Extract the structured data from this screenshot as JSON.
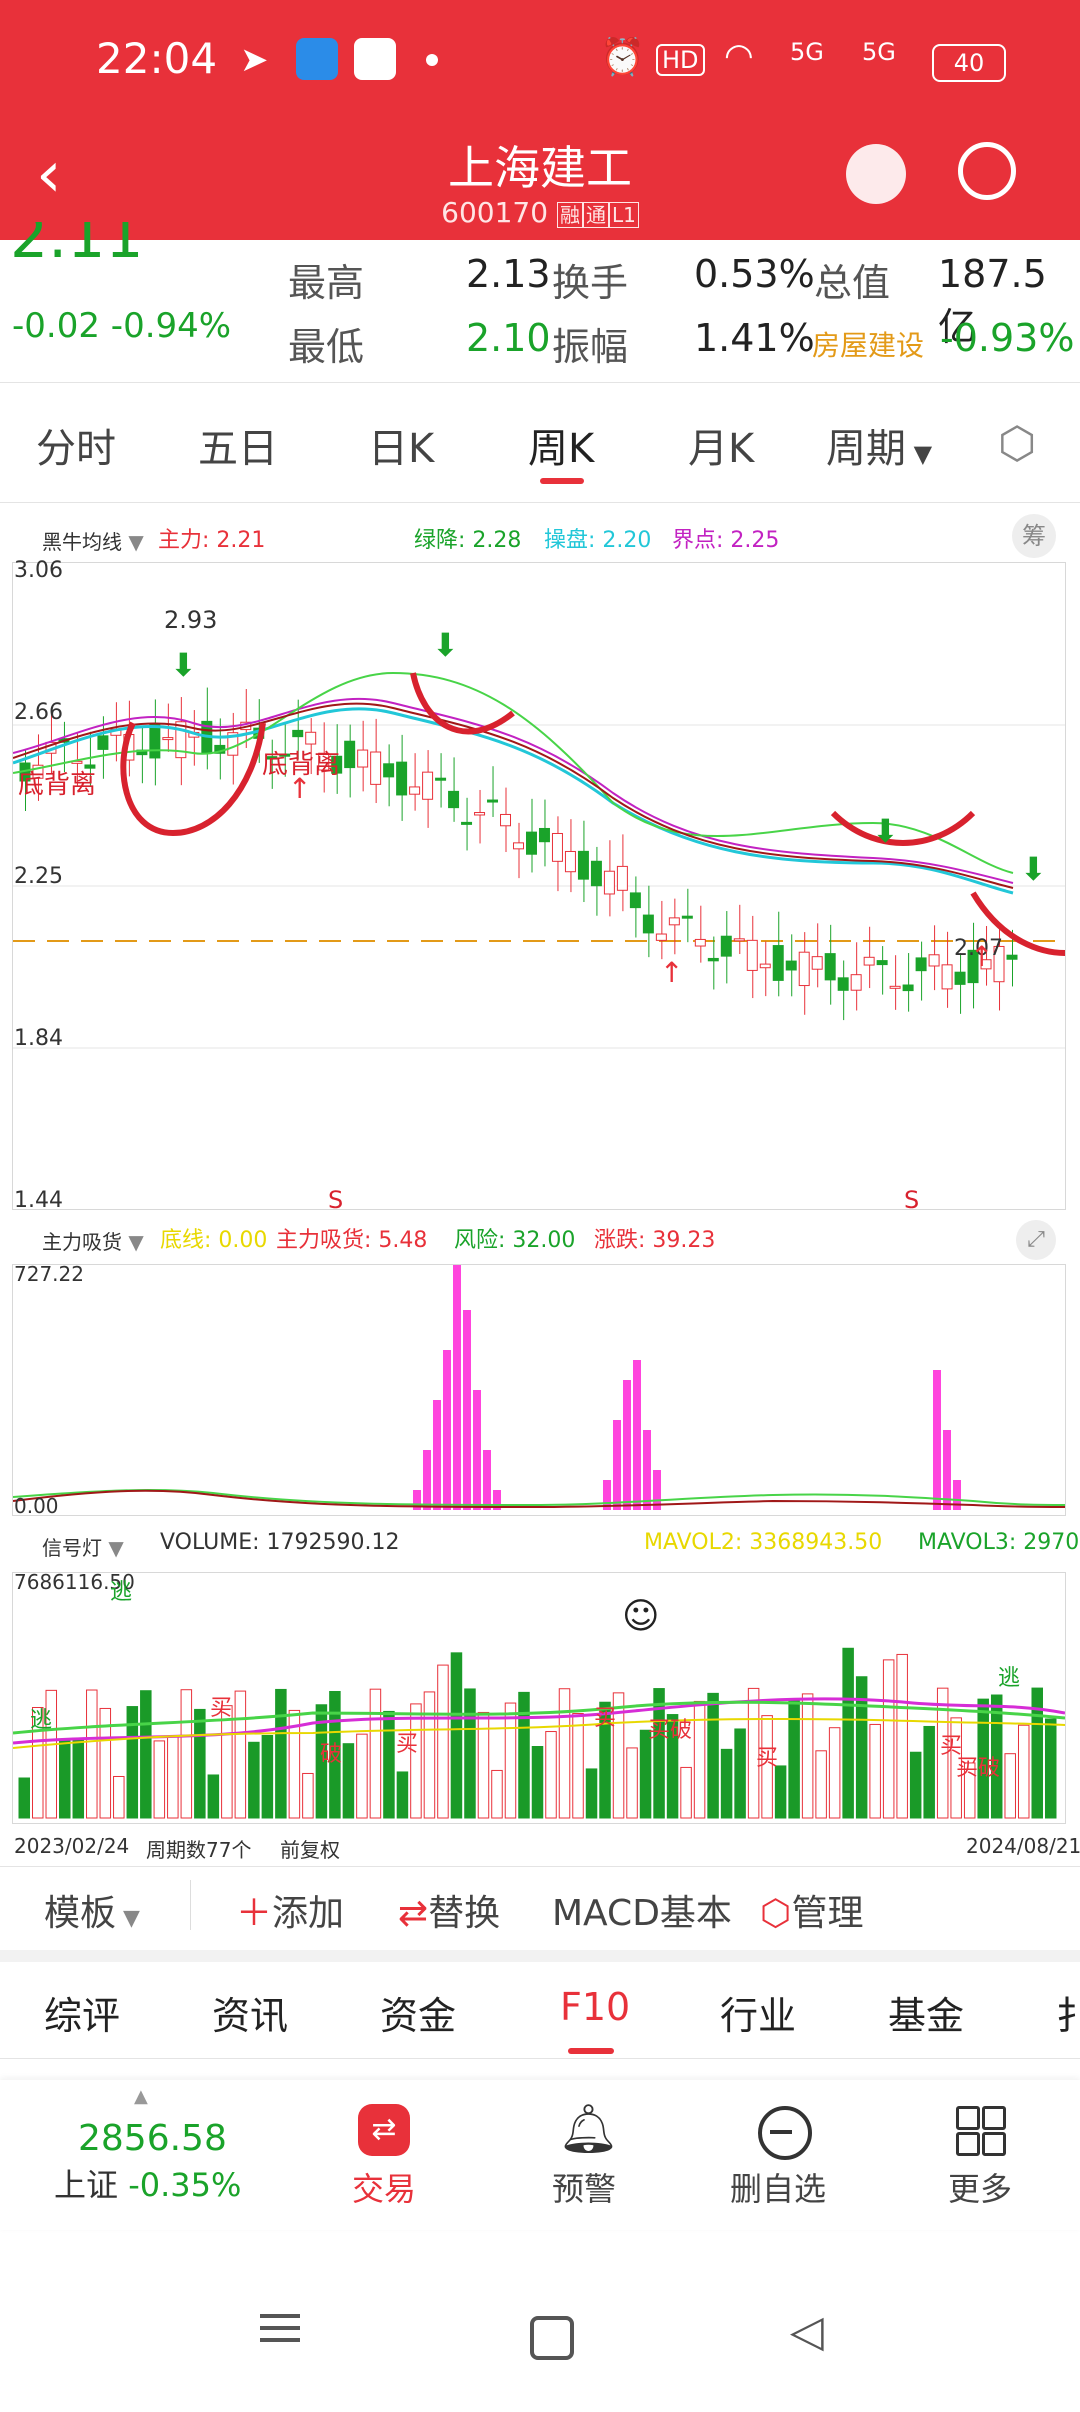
{
  "status": {
    "time": "22:04",
    "hd_badge": "HD",
    "net1": "5G",
    "net2": "5G",
    "battery": "40"
  },
  "header": {
    "title": "上海建工",
    "code": "600170",
    "badge1": "融",
    "badge2": "通",
    "badge3": "L1"
  },
  "quote": {
    "price": "2.11",
    "change": "-0.02",
    "change_pct": "-0.94%",
    "high_label": "最高",
    "high": "2.13",
    "turnover_label": "换手",
    "turnover": "0.53%",
    "cap_label": "总值",
    "cap": "187.5亿",
    "low_label": "最低",
    "low": "2.10",
    "amp_label": "振幅",
    "amp": "1.41%",
    "sector_label": "房屋建设",
    "sector_pct": "-0.93%"
  },
  "tabs": [
    "分时",
    "五日",
    "日K",
    "周K",
    "月K",
    "周期"
  ],
  "active_tab": "周K",
  "main_chart": {
    "indicator_name": "黑牛均线",
    "legend": [
      {
        "text": "主力: 2.21",
        "color": "#e8313a"
      },
      {
        "text": "绿降: 2.28",
        "color": "#1aa32a"
      },
      {
        "text": "操盘: 2.20",
        "color": "#22c7d8"
      },
      {
        "text": "界点: 2.25",
        "color": "#c222c2"
      }
    ],
    "chip_label": "筹",
    "y_labels": [
      "3.06",
      "2.66",
      "2.25",
      "1.84",
      "1.44"
    ],
    "high_mark": "2.93",
    "low_mark": "2.07",
    "annotations": [
      "底背离",
      "底背离",
      "S",
      "S"
    ]
  },
  "sub1": {
    "name": "主力吸货",
    "legend": [
      {
        "text": "底线: 0.00",
        "color": "#e8d800"
      },
      {
        "text": "主力吸货: 5.48",
        "color": "#e8313a"
      },
      {
        "text": "风险: 32.00",
        "color": "#1aa32a"
      },
      {
        "text": "涨跌: 39.23",
        "color": "#e8313a"
      }
    ],
    "y_top": "727.22",
    "y_bottom": "0.00"
  },
  "sub2": {
    "name": "信号灯",
    "volume": "VOLUME: 1792590.12",
    "mavol2": "MAVOL2: 3368943.50",
    "mavol3": "MAVOL3: 2970",
    "y_top": "7686116.50",
    "y_bottom": "0.00",
    "labels": [
      "逃",
      "逃",
      "买",
      "破",
      "买",
      "买",
      "买破",
      "买",
      "买",
      "买破",
      "逃"
    ]
  },
  "axis": {
    "start_date": "2023/02/24",
    "period_count": "周期数77个",
    "adjust": "前复权",
    "end_date": "2024/08/21"
  },
  "toolbar": {
    "template": "模板",
    "add": "添加",
    "replace": "替换",
    "macd": "MACD基本",
    "manage": "管理"
  },
  "subtabs": [
    "综评",
    "资讯",
    "资金",
    "F10",
    "行业",
    "基金",
    "扌"
  ],
  "active_subtab": "F10",
  "bottom_nav": {
    "index_value": "2856.58",
    "index_name": "上证",
    "index_pct": "-0.35%",
    "trade": "交易",
    "alert": "预警",
    "remove": "删自选",
    "more": "更多"
  }
}
